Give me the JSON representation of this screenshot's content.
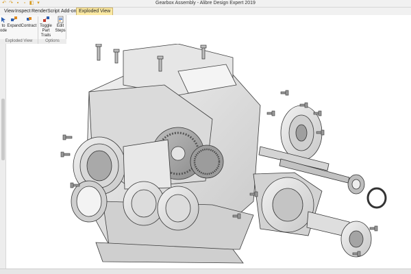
{
  "window": {
    "title": "Gearbox Assembly - Alibre Design Expert 2019"
  },
  "quick_access": [
    "undo-icon",
    "redo-icon",
    "save-icon",
    "print-icon",
    "folder-icon",
    "dropdown-icon"
  ],
  "tabs": [
    {
      "label": "View",
      "active": false
    },
    {
      "label": "Inspect",
      "active": false
    },
    {
      "label": "Render",
      "active": false
    },
    {
      "label": "Script",
      "active": false
    },
    {
      "label": "Add-on",
      "active": false
    },
    {
      "label": "Exploded View",
      "active": true
    }
  ],
  "ribbon": {
    "buttons": [
      {
        "line1": "to",
        "line2": "ode",
        "icon": "arrow-icon"
      },
      {
        "line1": "Expand",
        "line2": "",
        "icon": "expand-icon"
      },
      {
        "line1": "Contract",
        "line2": "",
        "icon": "contract-icon"
      },
      {
        "line1": "Toggle",
        "line2": "Part Trails",
        "icon": "toggle-trails-icon"
      },
      {
        "line1": "Edit",
        "line2": "Steps",
        "icon": "edit-steps-icon"
      }
    ],
    "groups": [
      {
        "label": "Exploded View"
      },
      {
        "label": "Options"
      }
    ]
  },
  "colors": {
    "accent": "#fbe9a3",
    "model_body": "#dcdcdc",
    "model_edge": "#3a3a3a"
  }
}
